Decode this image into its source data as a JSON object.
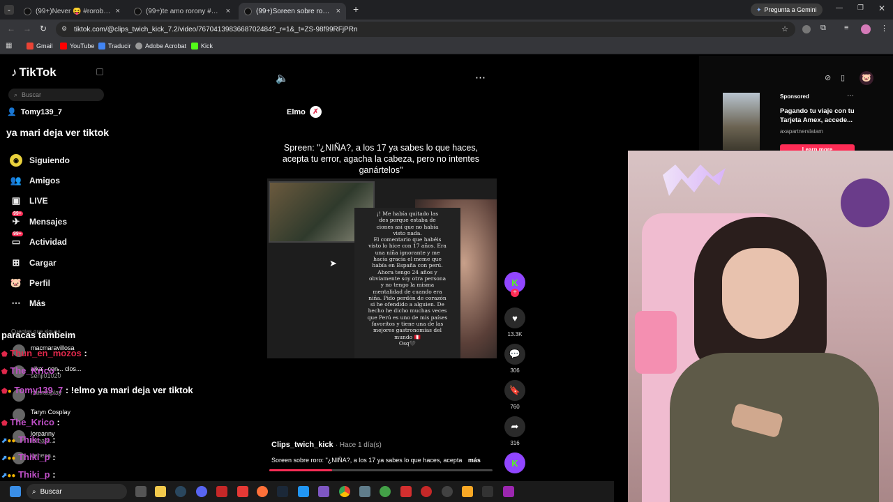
{
  "browser": {
    "tabs": [
      {
        "title": "(99+)Never 😝 #rorobo..."
      },
      {
        "title": "(99+)te amo rorony #paratiiiii"
      },
      {
        "title": "(99+)Soreen sobre roro: \"¿NIÑ..."
      }
    ],
    "new_tab_label": "+",
    "gemini_label": "Pregunta a Gemini",
    "url": "tiktok.com/@clips_twich_kick_7.2/video/7670413983668702484?_r=1&_t=ZS-98f99RFjPRn",
    "bookmarks": [
      "Gmail",
      "YouTube",
      "Traducir",
      "Adobe Acrobat",
      "Kick"
    ]
  },
  "tiktok": {
    "logo": "TikTok",
    "search_placeholder": "Buscar",
    "username": "Tomy139_7",
    "nav": [
      {
        "label": "Siguiendo",
        "icon": "following-icon"
      },
      {
        "label": "Amigos",
        "icon": "friends-icon"
      },
      {
        "label": "LIVE",
        "icon": "live-icon"
      },
      {
        "label": "Mensajes",
        "icon": "messages-icon",
        "badge": "99+"
      },
      {
        "label": "Actividad",
        "icon": "activity-icon",
        "badge": "99+"
      },
      {
        "label": "Cargar",
        "icon": "upload-icon"
      },
      {
        "label": "Perfil",
        "icon": "profile-icon"
      },
      {
        "label": "Más",
        "icon": "more-icon"
      }
    ],
    "following_heading": "Cuentas que sigues",
    "following": [
      {
        "name": "macmaravillosa",
        "handle": ""
      },
      {
        "name": "aika · con... clos...",
        "handle": "senji01020"
      },
      {
        "name": "",
        "handle": "nattrauplay"
      },
      {
        "name": "Taryn Cosplay",
        "handle": ""
      },
      {
        "name": "loreanny",
        "handle": "lorean..."
      },
      {
        "name": "",
        "handle": "venesa..."
      }
    ],
    "video": {
      "creator_tag": "Elmo",
      "caption_title": "Spreen: \"¿NIÑA?, a los 17 ya sabes lo que haces, acepta tu error, agacha la cabeza, pero no intentes ganártelos\"",
      "screenshot_text": [
        "¡! Me había quitado las",
        "des porque estaba de",
        "ciones así que no había",
        "visto nada.",
        "El comentario que habéis",
        "visto lo hice con 17 años. Era",
        "una niña ignorante y me",
        "hacía gracia el meme que",
        "había en España con perú.",
        "Ahora tengo 24 años y",
        "obviamente soy otra persona",
        "y no tengo la misma",
        "mentalidad de cuando era",
        "niña. Pido perdón de corazón",
        "si he ofendido a alguien. De",
        "hecho he dicho muchas veces",
        "que Perú es uno de mis países",
        "favoritos y tiene una de las",
        "mejores gastronomías del",
        "mundo 🇵🇪",
        "Osq🖤"
      ],
      "author": "Clips_twich_kick",
      "posted": "· Hace 1 día(s)",
      "description": "Soreen sobre roro: \"¿NIÑA?, a los 17 ya sabes lo que haces, acepta",
      "more_label": "más",
      "progress": 0.28,
      "likes": "13.3K",
      "comments": "306",
      "saves": "760",
      "shares": "316"
    },
    "ad": {
      "label": "Sponsored",
      "text": "Pagando tu viaje con tu Tarjeta Amex, accede...",
      "account": "axapartnerslatam",
      "cta": "Learn more"
    }
  },
  "stream_chat": [
    {
      "user": "paracas tambeim",
      "msg": "",
      "color": "#ffffff"
    },
    {
      "user": "Thun_en_mozos",
      "msg": ":",
      "color": "#e0284b"
    },
    {
      "user": "The_Krico",
      "msg": ":",
      "color": "#c050c8"
    },
    {
      "user": "Tomy139_7",
      "msg": ": !elmo ya mari deja ver tiktok",
      "color": "#c050c8"
    },
    {
      "user": "The_Krico",
      "msg": ":",
      "color": "#c050c8"
    },
    {
      "user": "Thiki_p",
      "msg": ":",
      "color": "#c050c8"
    },
    {
      "user": "Thiki_p",
      "msg": ":",
      "color": "#c050c8"
    },
    {
      "user": "Thiki_p",
      "msg": ":",
      "color": "#c050c8"
    }
  ],
  "overlay_message": "ya mari deja ver tiktok",
  "taskbar": {
    "search_label": "Buscar"
  },
  "colors": {
    "accent": "#fe2c55",
    "twitch": "#9146ff",
    "kick": "#53fc18"
  }
}
